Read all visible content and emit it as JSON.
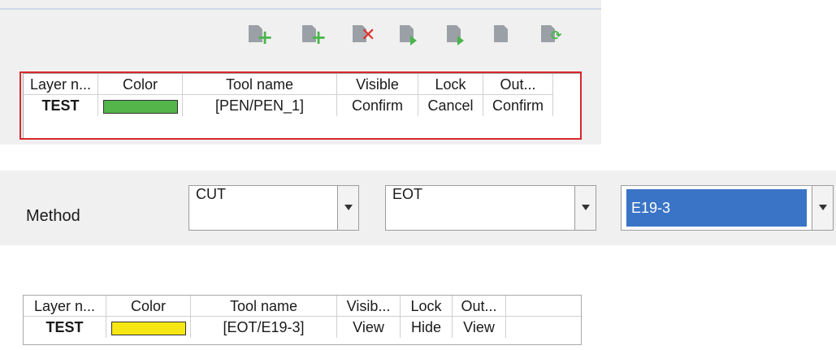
{
  "toolbar": {
    "buttons": [
      {
        "icon": "layer-add-icon"
      },
      {
        "icon": "layer-insert-icon"
      },
      {
        "icon": "layer-delete-icon"
      },
      {
        "icon": "layer-move-up-icon"
      },
      {
        "icon": "layer-move-down-icon"
      },
      {
        "icon": "layer-copy-icon"
      },
      {
        "icon": "layer-refresh-icon"
      }
    ]
  },
  "table1": {
    "columns": [
      "Layer n...",
      "Color",
      "Tool name",
      "Visible",
      "Lock",
      "Out..."
    ],
    "rows": [
      {
        "layer": "TEST",
        "color": "#53b54a",
        "tool": "[PEN/PEN_1]",
        "visible": "Confirm",
        "lock": "Cancel",
        "out": "Confirm"
      }
    ],
    "highlight_color": "#d9262b"
  },
  "method": {
    "label": "Method",
    "combos": [
      {
        "value": "CUT"
      },
      {
        "value": "EOT"
      },
      {
        "value": "E19-3"
      }
    ]
  },
  "table2": {
    "columns": [
      "Layer n...",
      "Color",
      "Tool name",
      "Visib...",
      "Lock",
      "Out..."
    ],
    "rows": [
      {
        "layer": "TEST",
        "color": "#f5e614",
        "tool": "[EOT/E19-3]",
        "visible": "View",
        "lock": "Hide",
        "out": "View"
      }
    ]
  }
}
